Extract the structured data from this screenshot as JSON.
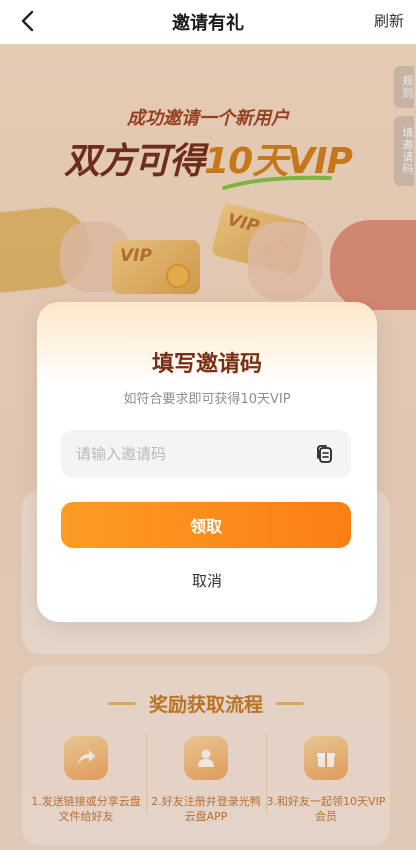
{
  "nav": {
    "title": "邀请有礼",
    "refresh_label": "刷新"
  },
  "side_tabs": {
    "rules": "规则",
    "fill_code": "填邀请码"
  },
  "hero": {
    "subtitle": "成功邀请一个新用户",
    "main_prefix": "双方可得",
    "main_highlight": "10天VIP"
  },
  "cards": {
    "vip_left": "VIP",
    "vip_right": "VIP"
  },
  "modal": {
    "title": "填写邀请码",
    "subtitle": "如符合要求即可获得10天VIP",
    "input_placeholder": "请输入邀请码",
    "input_value": "",
    "claim_label": "领取",
    "cancel_label": "取消"
  },
  "flow": {
    "title": "奖励获取流程",
    "steps": [
      {
        "text": "1.发送链接或分享云盘文件给好友",
        "icon": "share-icon"
      },
      {
        "text": "2.好友注册并登录光鸭云盘APP",
        "icon": "user-icon"
      },
      {
        "text": "3.和好友一起领10天VIP会员",
        "icon": "gift-icon"
      }
    ]
  },
  "colors": {
    "accent": "#fd8a1c",
    "title_brown": "#7a2e12",
    "flow_orange": "#c2751a"
  }
}
